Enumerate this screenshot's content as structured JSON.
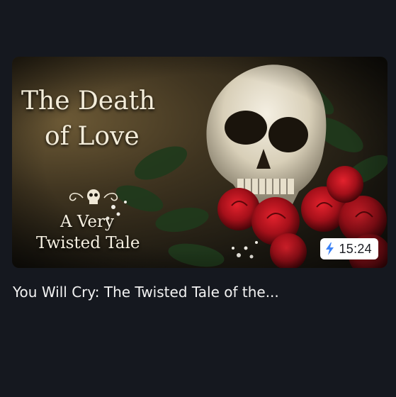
{
  "video": {
    "thumbnail": {
      "title_line1": "The Death",
      "title_line2": "of Love",
      "subtitle_line1": "A Very",
      "subtitle_line2": "Twisted Tale",
      "imagery": [
        "skull",
        "red-roses",
        "ivy-leaves",
        "babys-breath"
      ]
    },
    "duration": "15:24",
    "duration_icon": "lightning-bolt-icon",
    "title": "You Will Cry: The Twisted Tale of the..."
  },
  "colors": {
    "background": "#15181f",
    "accent_bolt": "#3b82f6",
    "rose_red": "#b3121c"
  }
}
